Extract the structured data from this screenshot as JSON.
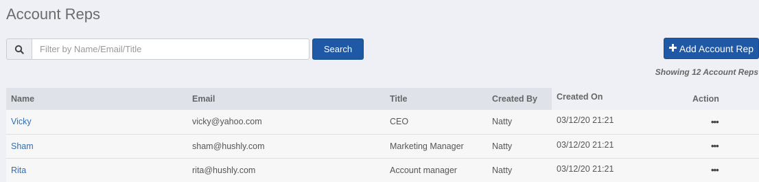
{
  "page": {
    "title": "Account Reps"
  },
  "search": {
    "icon": "search-icon",
    "placeholder": "Filter by Name/Email/Title",
    "button_label": "Search"
  },
  "add_button": {
    "icon": "plus-icon",
    "label": "Add Account Rep"
  },
  "summary": "Showing 12 Account Reps",
  "table": {
    "columns": [
      "Name",
      "Email",
      "Title",
      "Created By",
      "Created On",
      "Action"
    ],
    "rows": [
      {
        "name": "Vicky",
        "email": "vicky@yahoo.com",
        "title": "CEO",
        "created_by": "Natty",
        "created_on": "03/12/20 21:21",
        "action": "•••"
      },
      {
        "name": "Sham",
        "email": "sham@hushly.com",
        "title": "Marketing Manager",
        "created_by": "Natty",
        "created_on": "03/12/20 21:21",
        "action": "•••"
      },
      {
        "name": "Rita",
        "email": "rita@hushly.com",
        "title": "Account manager",
        "created_by": "Natty",
        "created_on": "03/12/20 21:21",
        "action": "•••"
      }
    ]
  },
  "colors": {
    "primary": "#1f58a5",
    "link": "#2f6db3",
    "background": "#eff0f5",
    "header": "#dfe2e8"
  }
}
